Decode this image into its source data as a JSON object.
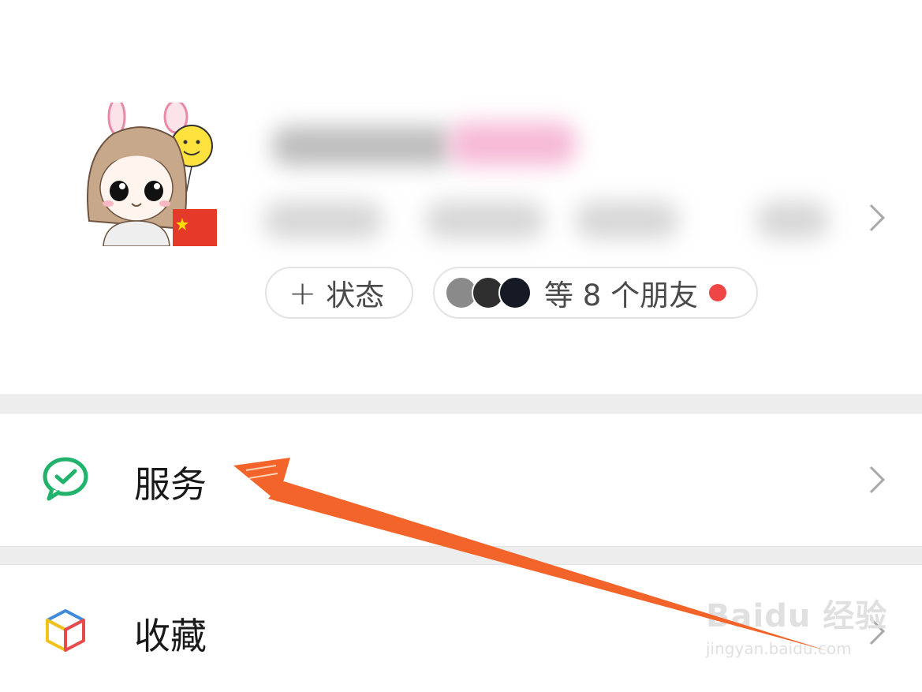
{
  "profile": {
    "status_button": {
      "icon": "plus",
      "label": "状态"
    },
    "friends_button": {
      "label": "等 8 个朋友",
      "dot_color": "#f04545"
    },
    "avatar_flag": "china-flag"
  },
  "menu": [
    {
      "label": "服务",
      "icon": "wechat-pay-icon",
      "accent": "#21b36b"
    },
    {
      "label": "收藏",
      "icon": "favorites-cube-icon"
    }
  ],
  "watermark": {
    "main": "Baidu 经验",
    "sub": "jingyan.baidu.com"
  },
  "annotation": {
    "color": "#f2642a"
  }
}
